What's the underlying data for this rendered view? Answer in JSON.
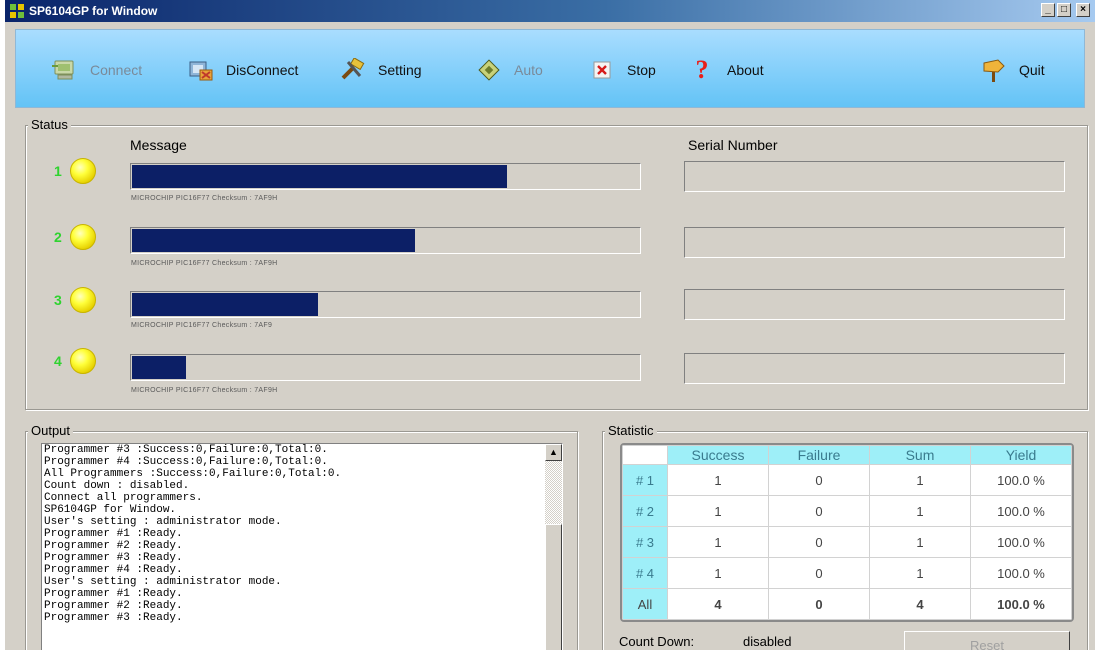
{
  "window": {
    "title": "SP6104GP for Window",
    "controls": [
      "_",
      "□",
      "×"
    ]
  },
  "toolbar": {
    "buttons": [
      {
        "label": "Connect",
        "icon": "computer-connect-icon",
        "enabled": false
      },
      {
        "label": "DisConnect",
        "icon": "disconnect-icon",
        "enabled": true
      },
      {
        "label": "Setting",
        "icon": "tools-icon",
        "enabled": true
      },
      {
        "label": "Auto",
        "icon": "chip-icon",
        "enabled": false
      },
      {
        "label": "Stop",
        "icon": "stop-icon",
        "enabled": true
      },
      {
        "label": "About",
        "icon": "question-icon",
        "enabled": true
      },
      {
        "label": "Quit",
        "icon": "exit-sign-icon",
        "enabled": true
      }
    ]
  },
  "status": {
    "legend": "Status",
    "message_header": "Message",
    "serial_header": "Serial Number",
    "programmers": [
      {
        "id": "1",
        "progress": 0.74,
        "detail": "MICROCHIP PIC16F77 Checksum : 7AF9H",
        "serial": ""
      },
      {
        "id": "2",
        "progress": 0.56,
        "detail": "MICROCHIP PIC16F77 Checksum : 7AF9H",
        "serial": ""
      },
      {
        "id": "3",
        "progress": 0.37,
        "detail": "MICROCHIP PIC16F77 Checksum : 7AF9",
        "serial": ""
      },
      {
        "id": "4",
        "progress": 0.11,
        "detail": "MICROCHIP PIC16F77 Checksum : 7AF9H",
        "serial": ""
      }
    ]
  },
  "output": {
    "legend": "Output",
    "lines": [
      "Programmer #3 :Success:0,Failure:0,Total:0.",
      "Programmer #4 :Success:0,Failure:0,Total:0.",
      "All Programmers :Success:0,Failure:0,Total:0.",
      "Count down : disabled.",
      "Connect all programmers.",
      "SP6104GP for Window.",
      "User's setting : administrator mode.",
      "Programmer #1 :Ready.",
      "Programmer #2 :Ready.",
      "Programmer #3 :Ready.",
      "Programmer #4 :Ready.",
      "User's setting : administrator mode.",
      "Programmer #1 :Ready.",
      "Programmer #2 :Ready.",
      "Programmer #3 :Ready."
    ]
  },
  "statistic": {
    "legend": "Statistic",
    "columns": [
      "Success",
      "Failure",
      "Sum",
      "Yield"
    ],
    "rows": [
      {
        "label": "# 1",
        "values": [
          "1",
          "0",
          "1",
          "100.0 %"
        ]
      },
      {
        "label": "# 2",
        "values": [
          "1",
          "0",
          "1",
          "100.0 %"
        ]
      },
      {
        "label": "# 3",
        "values": [
          "1",
          "0",
          "1",
          "100.0 %"
        ]
      },
      {
        "label": "# 4",
        "values": [
          "1",
          "0",
          "1",
          "100.0 %"
        ]
      },
      {
        "label": "All",
        "values": [
          "4",
          "0",
          "4",
          "100.0 %"
        ]
      }
    ],
    "count_down_label": "Count Down:",
    "count_down_value": "disabled",
    "reset_label": "Reset"
  },
  "colors": {
    "progress_fill": "#0c1f66",
    "led_yellow": "#ffff3a",
    "programmer_number": "#2fd32f",
    "table_header_bg": "#9eeff8",
    "toolbar_bg": "#63c3f6"
  }
}
